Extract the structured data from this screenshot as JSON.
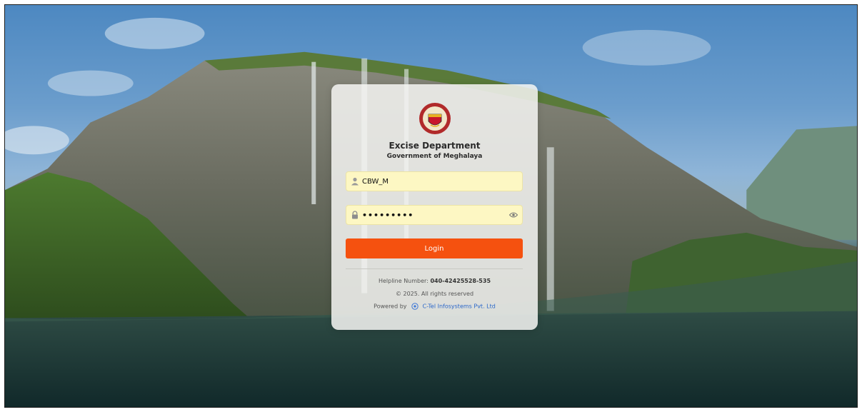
{
  "header": {
    "department": "Excise Department",
    "government": "Government of Meghalaya"
  },
  "login_form": {
    "username_value": "CBW_M",
    "password_value": "•••••••••",
    "login_label": "Login"
  },
  "footer": {
    "helpline_label": "Helpline Number:",
    "helpline_number": "040-42425528-535",
    "copyright": "© 2025. All rights reserved",
    "powered_by_label": "Powered by",
    "company": "C-Tel Infosystems Pvt. Ltd"
  },
  "colors": {
    "login_button": "#f5510f",
    "input_background": "#fdf7c3",
    "link": "#2b67c9"
  },
  "icons": {
    "user": "user-icon",
    "lock": "lock-icon",
    "password_toggle": "eye-icon",
    "logo": "excise-department-logo",
    "company_logo": "ctel-icon"
  }
}
